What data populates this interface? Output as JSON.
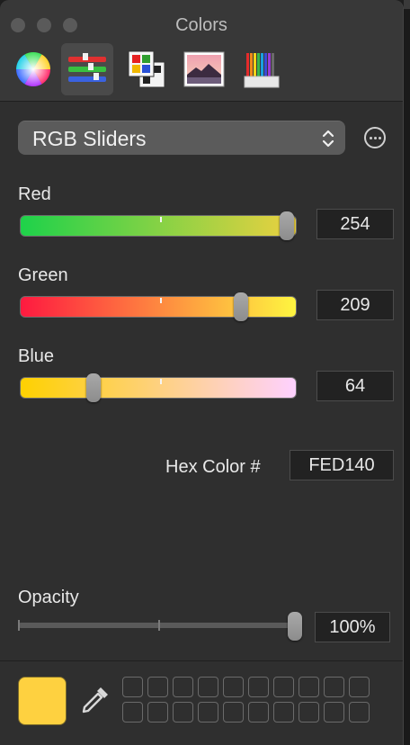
{
  "window": {
    "title": "Colors"
  },
  "toolbar": {
    "tabs": [
      {
        "icon": "color-wheel-icon"
      },
      {
        "icon": "color-sliders-icon",
        "selected": true
      },
      {
        "icon": "color-palettes-icon"
      },
      {
        "icon": "image-palettes-icon"
      },
      {
        "icon": "pencils-icon"
      }
    ]
  },
  "mode": {
    "selected": "RGB Sliders"
  },
  "sliders": [
    {
      "label": "Red",
      "value": "254",
      "fraction": 0.996,
      "gradient": [
        "#1ed24a",
        "#ecd140"
      ]
    },
    {
      "label": "Green",
      "value": "209",
      "fraction": 0.82,
      "gradient": [
        "#fe1a40",
        "#fef540"
      ]
    },
    {
      "label": "Blue",
      "value": "64",
      "fraction": 0.251,
      "gradient": [
        "#fed100",
        "#fed1ff"
      ]
    }
  ],
  "hex": {
    "label": "Hex Color #",
    "value": "FED140"
  },
  "opacity": {
    "label": "Opacity",
    "value": "100%",
    "fraction": 1.0
  },
  "current_color": "#FED140",
  "colors": {
    "selected_tab_bg": "#4a4a4a",
    "panel_bg": "#2f2f2f"
  }
}
